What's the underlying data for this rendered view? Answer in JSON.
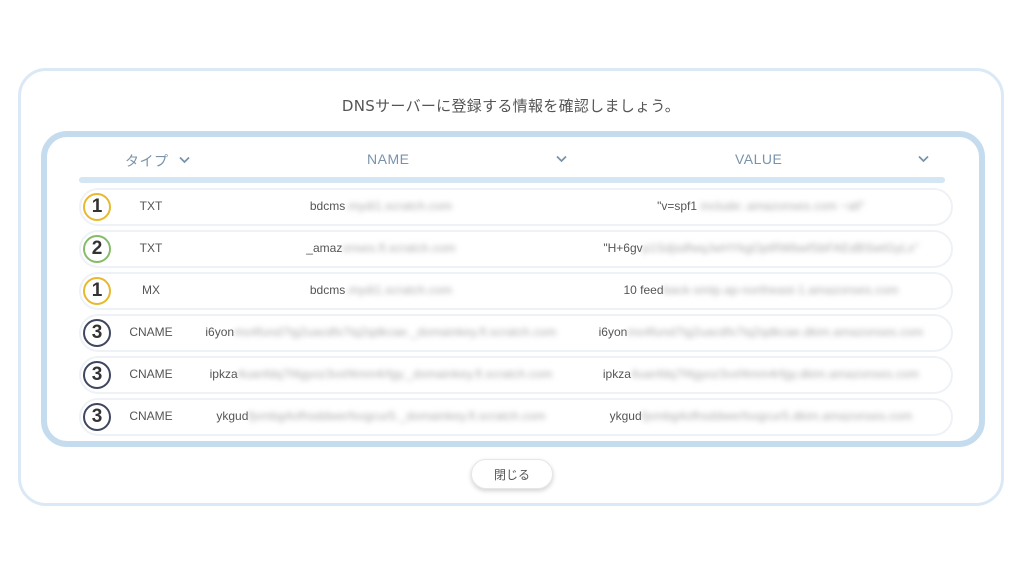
{
  "dialog": {
    "title": "DNSサーバーに登録する情報を確認しましょう。",
    "close_label": "閉じる"
  },
  "table": {
    "headers": {
      "type": "タイプ",
      "name": "NAME",
      "value": "VALUE"
    },
    "rows": [
      {
        "badge": "1",
        "type": "TXT",
        "name_visible": "bdcms",
        "name_blurred": ".mydi1.scratch.com",
        "value_visible": "\"v=spf1",
        "value_blurred": " include:.amazonses.com ~all\""
      },
      {
        "badge": "2",
        "type": "TXT",
        "name_visible": "_amaz",
        "name_blurred": "onses.fl.scratch.com",
        "value_visible": "\"H+6gv",
        "value_blurred": "p1SdjsdfwqJwHYkgOptRWbwfSbFAEdBSwtGyLx\""
      },
      {
        "badge": "1",
        "type": "MX",
        "name_visible": "bdcms",
        "name_blurred": ".mydi1.scratch.com",
        "value_visible": "10 feed",
        "value_blurred": "back-smtp.ap-northeast-1.amazonses.com"
      },
      {
        "badge": "3",
        "type": "CNAME",
        "name_visible": "i6yon",
        "name_blurred": "mo4fund7tg2uacdfx7tq2qdkcae._domainkey.fl.scratch.com",
        "value_visible": "i6yon",
        "value_blurred": "mo4fund7tg2uacdfx7tq2qdkcae.dkim.amazonses.com"
      },
      {
        "badge": "3",
        "type": "CNAME",
        "name_visible": "ipkza",
        "name_blurred": "4uanfdq7f4gyoz3vxf4mm4rfgy._domainkey.fl.scratch.com",
        "value_visible": "ipkza",
        "value_blurred": "4uanfdq7f4gyoz3vxf4mm4rfgy.dkim.amazonses.com"
      },
      {
        "badge": "3",
        "type": "CNAME",
        "name_visible": "ykgud",
        "name_blurred": "fjxmbg4ofhsddwerfsvgcur5._domainkey.fl.scratch.com",
        "value_visible": "ykgud",
        "value_blurred": "fjxmbg4ofhsddwerfsvgcur5.dkim.amazonses.com"
      }
    ]
  },
  "colors": {
    "badge_1": "#e7b92e",
    "badge_2": "#86bb6a",
    "badge_3": "#3e4660",
    "panel_border": "#c5dcef",
    "header_text": "#7a93aa"
  },
  "icons": {
    "sort": "chevron-down-icon"
  }
}
